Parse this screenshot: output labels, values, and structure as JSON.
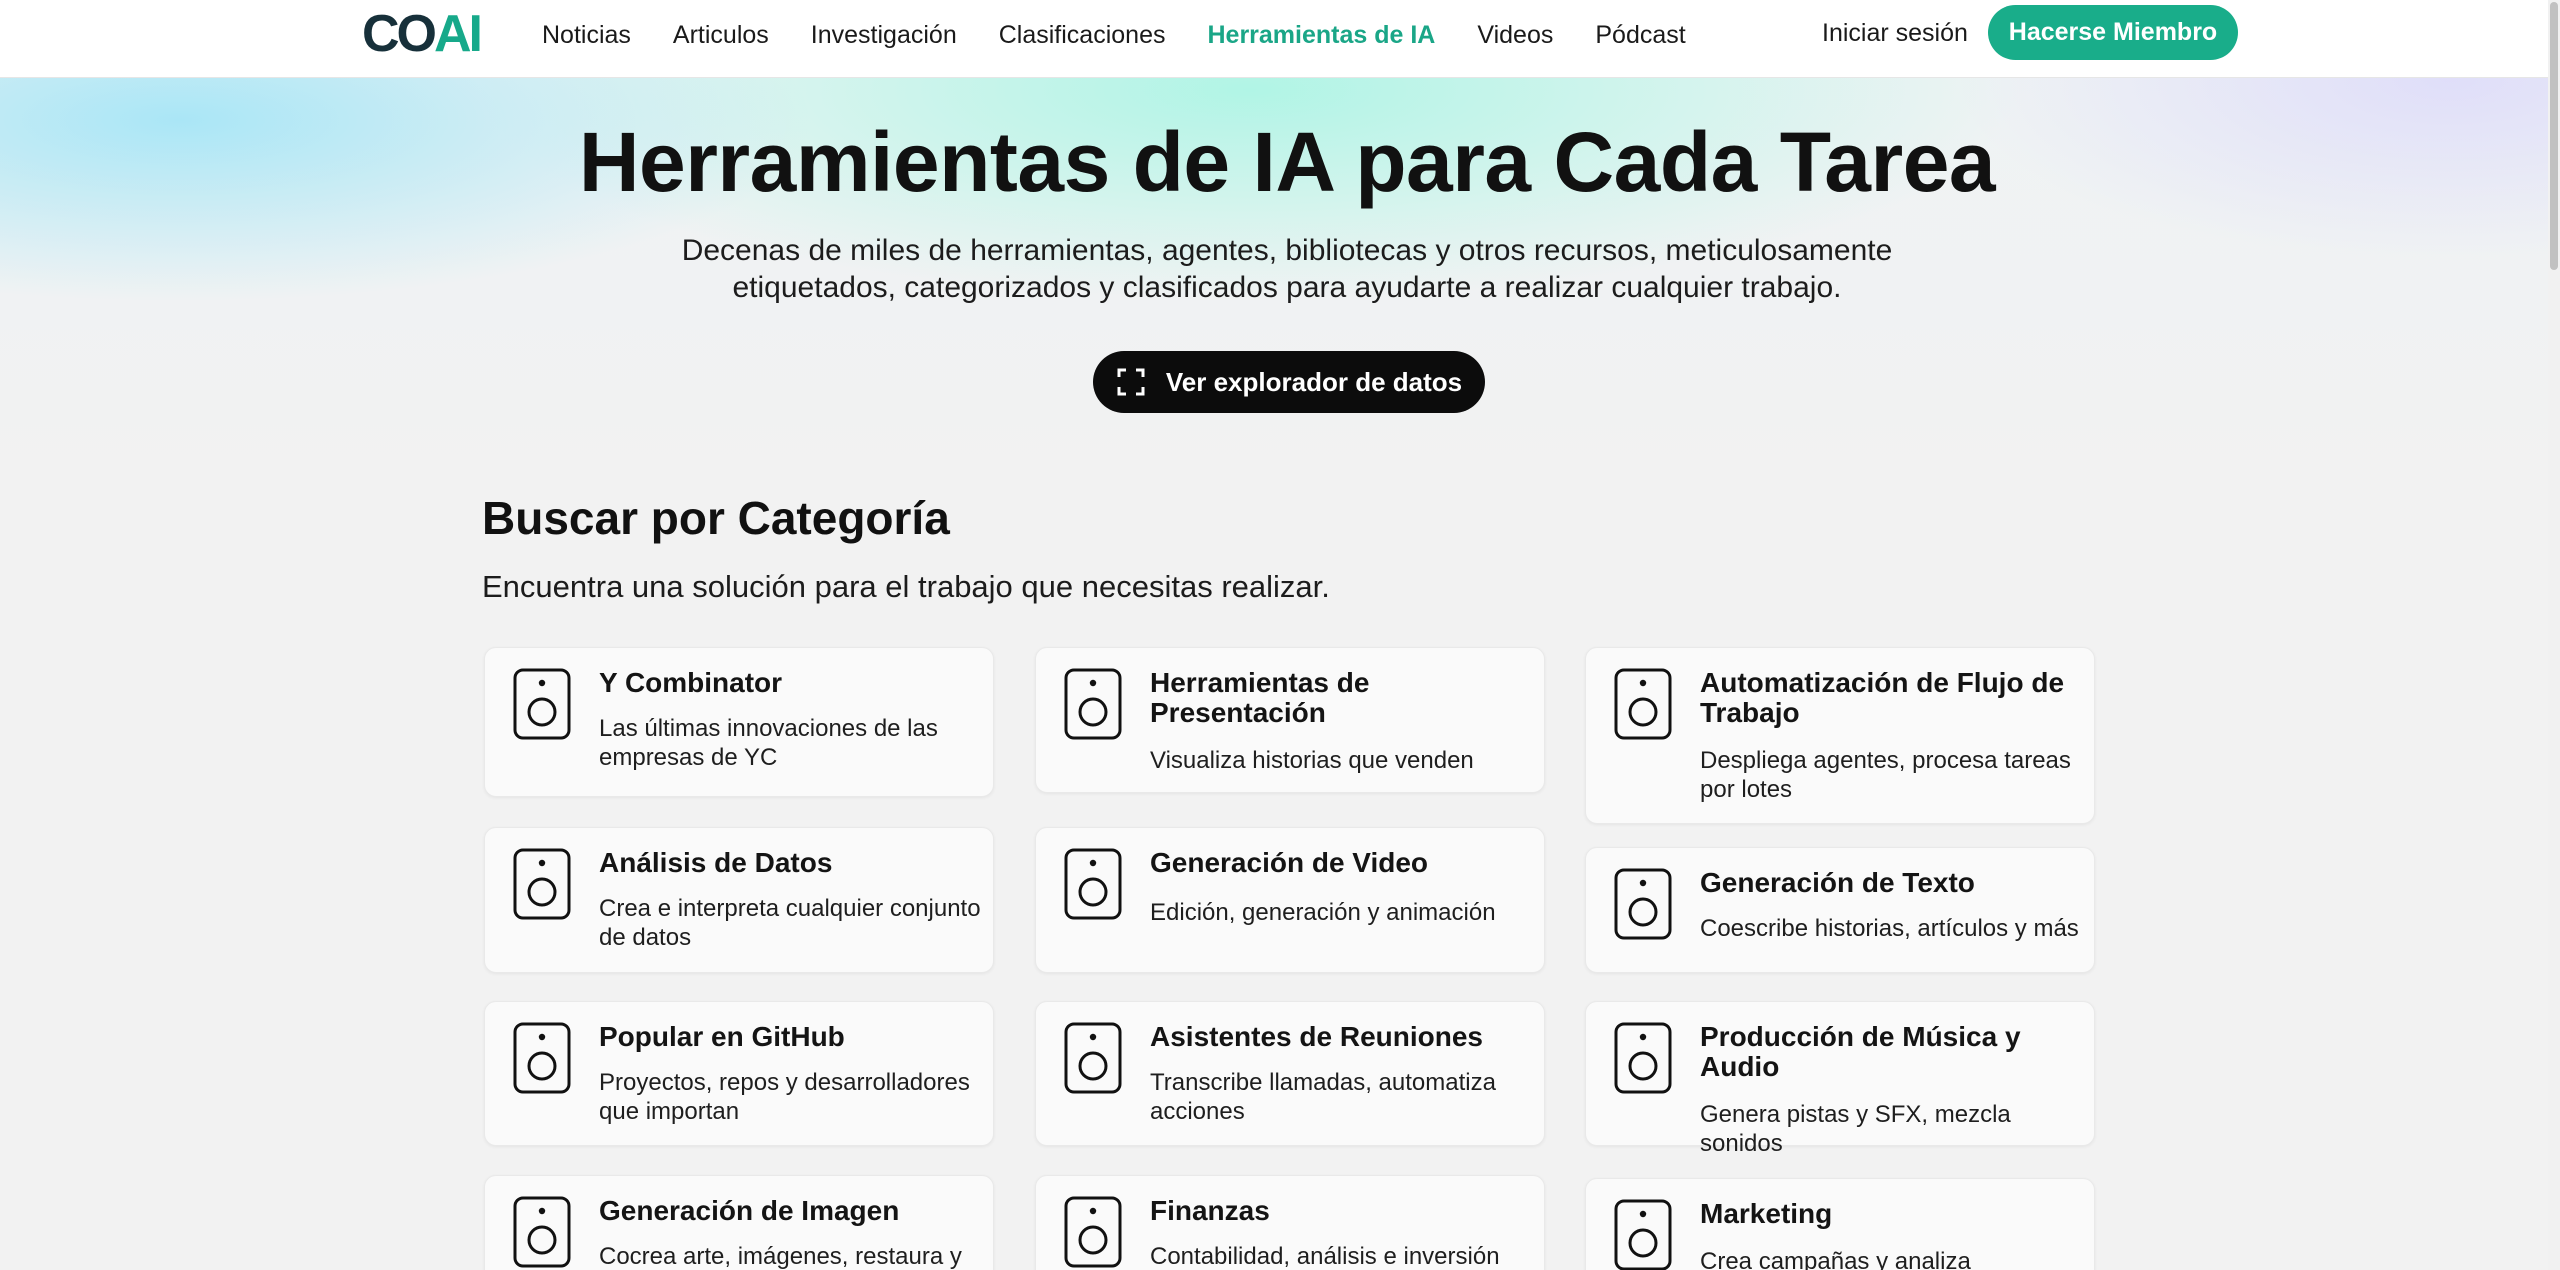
{
  "nav": {
    "logo_part1": "CO",
    "logo_part2": "AI",
    "links": [
      "Noticias",
      "Articulos",
      "Investigación",
      "Clasificaciones",
      "Herramientas de IA",
      "Videos",
      "Pódcast"
    ],
    "login": "Iniciar sesión",
    "join": "Hacerse Miembro"
  },
  "hero": {
    "title": "Herramientas de IA para Cada Tarea",
    "subtitle": "Decenas de miles de herramientas, agentes, bibliotecas y otros recursos, meticulosamente etiquetados, categorizados y clasificados para ayudarte a realizar cualquier trabajo.",
    "explore_button": "Ver explorador de datos"
  },
  "section": {
    "title": "Buscar por Categoría",
    "subtitle": "Encuentra una solución para el trabajo que necesitas realizar."
  },
  "categories": [
    {
      "title": "Y Combinator",
      "desc": "Las últimas innovaciones de las empresas de YC"
    },
    {
      "title": "Herramientas de Presentación",
      "desc": "Visualiza historias que venden"
    },
    {
      "title": "Automatización de Flujo de Trabajo",
      "desc": "Despliega agentes, procesa tareas por lotes"
    },
    {
      "title": "Análisis de Datos",
      "desc": "Crea e interpreta cualquier conjunto de datos"
    },
    {
      "title": "Generación de Video",
      "desc": "Edición, generación y animación"
    },
    {
      "title": "Generación de Texto",
      "desc": "Coescribe historias, artículos y más"
    },
    {
      "title": "Popular en GitHub",
      "desc": "Proyectos, repos y desarrolladores que importan"
    },
    {
      "title": "Asistentes de Reuniones",
      "desc": "Transcribe llamadas, automatiza acciones"
    },
    {
      "title": "Producción de Música y Audio",
      "desc": "Genera pistas y SFX, mezcla sonidos"
    },
    {
      "title": "Generación de Imagen",
      "desc": "Cocrea arte, imágenes, restaura y"
    },
    {
      "title": "Finanzas",
      "desc": "Contabilidad, análisis e inversión"
    },
    {
      "title": "Marketing",
      "desc": "Crea campañas y analiza"
    }
  ],
  "colors": {
    "accent": "#19ad8a",
    "dark": "#0c0c0c"
  }
}
